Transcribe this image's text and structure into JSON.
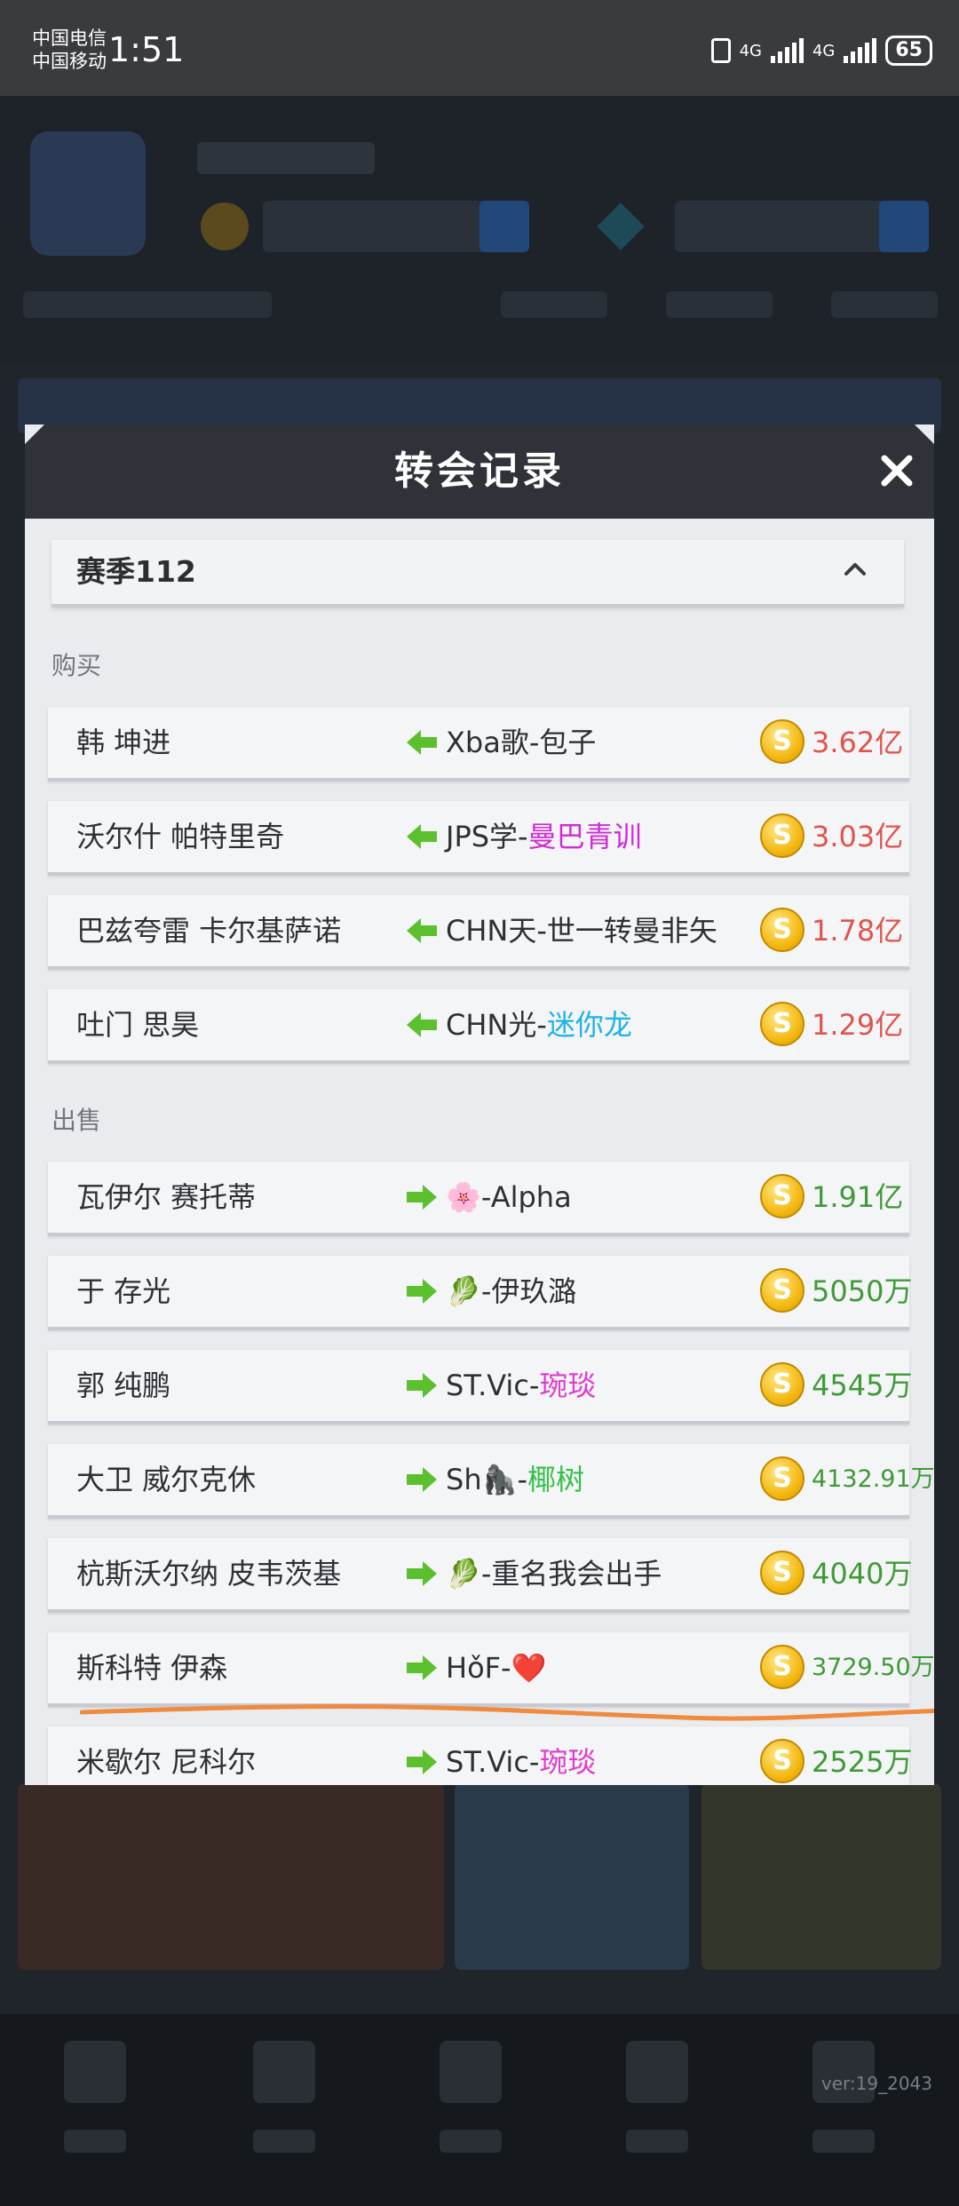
{
  "status_bar": {
    "carrier_1": "中国电信",
    "carrier_2": "中国移动",
    "time": "1:51",
    "network_1": "4G",
    "network_2": "4G",
    "battery": "65"
  },
  "modal": {
    "title": "转会记录",
    "season_label": "赛季112",
    "buy_section_label": "购买",
    "sell_section_label": "出售",
    "buy_rows": [
      {
        "player": "韩 坤进",
        "team_prefix": "Xba歌-",
        "team_suffix": "包子",
        "team_suffix_color": "#2e3035",
        "price": "3.62亿"
      },
      {
        "player": "沃尔什 帕特里奇",
        "team_prefix": "JPS学-",
        "team_suffix": "曼巴青训",
        "team_suffix_color": "#d12bd6",
        "price": "3.03亿"
      },
      {
        "player": "巴兹夸雷 卡尔基萨诺",
        "team_prefix": "CHN天-",
        "team_suffix": "世一转曼非矢",
        "team_suffix_color": "#2e3035",
        "price": "1.78亿"
      },
      {
        "player": "吐门 思昊",
        "team_prefix": "CHN光-",
        "team_suffix": "迷你龙",
        "team_suffix_color": "#1fb3e6",
        "price": "1.29亿"
      }
    ],
    "sell_rows": [
      {
        "player": "瓦伊尔 赛托蒂",
        "team_prefix": "🌸-",
        "team_suffix": "Alpha",
        "team_suffix_color": "#2e3035",
        "price": "1.91亿"
      },
      {
        "player": "于 存光",
        "team_prefix": "🥬-",
        "team_suffix": "伊玖潞",
        "team_suffix_color": "#2e3035",
        "price": "5050万"
      },
      {
        "player": "郭 纯鹏",
        "team_prefix": "ST.Vic-",
        "team_suffix": "琬琰",
        "team_suffix_color": "#e03ccf",
        "price": "4545万"
      },
      {
        "player": "大卫 威尔克休",
        "team_prefix": "Sh🦍-",
        "team_suffix": "椰树",
        "team_suffix_color": "#35c04a",
        "price": "4132.91万"
      },
      {
        "player": "杭斯沃尔纳 皮韦茨基",
        "team_prefix": "🥬-",
        "team_suffix": "重名我会出手",
        "team_suffix_color": "#2e3035",
        "price": "4040万"
      },
      {
        "player": "斯科特 伊森",
        "team_prefix": "HǒF-",
        "team_suffix": "❤️",
        "team_suffix_color": "#e0263a",
        "price": "3729.50万"
      },
      {
        "player": "米歇尔 尼科尔",
        "team_prefix": "ST.Vic-",
        "team_suffix": "琬琰",
        "team_suffix_color": "#e03ccf",
        "price": "2525万"
      }
    ],
    "coin_symbol": "S"
  },
  "footer": {
    "version": "ver:19_2043"
  },
  "colors": {
    "buy_price": "#e0544d",
    "sell_price": "#3e9a36",
    "arrow_green": "#5cc02e",
    "underline_orange": "#f08a3c"
  }
}
